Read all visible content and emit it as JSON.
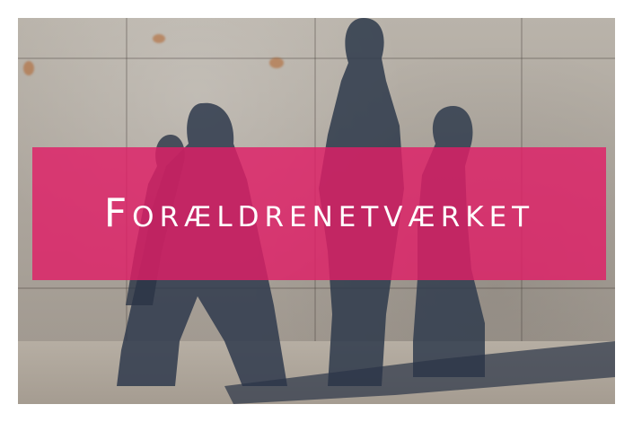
{
  "banner": {
    "title": "Forældrenetværket"
  },
  "colors": {
    "banner_pink": "#df1e67",
    "wall": "#aaa39a",
    "shadow": "#2f3a4c",
    "frame": "#ffffff"
  },
  "image": {
    "subject": "shadows-of-family-on-stone-wall"
  }
}
